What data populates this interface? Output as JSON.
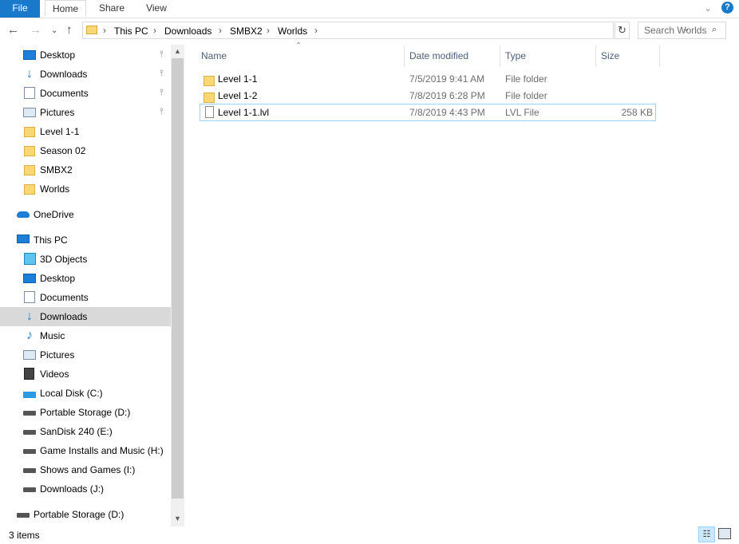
{
  "ribbon": {
    "tabs": [
      "File",
      "Home",
      "Share",
      "View"
    ],
    "help": "?",
    "chevron": "⌄"
  },
  "nav": {
    "back": "←",
    "forward": "→",
    "recent": "⌄",
    "up": "↑",
    "refresh": "↻"
  },
  "address": {
    "crumbs": [
      "This PC",
      "Downloads",
      "SMBX2",
      "Worlds"
    ],
    "sep": "›",
    "dropdown": "⌄"
  },
  "search": {
    "placeholder": "Search Worlds",
    "icon": "search-icon"
  },
  "sidebar": {
    "quick_access": [
      {
        "label": "Desktop",
        "icon": "desktop-icon",
        "pinned": true
      },
      {
        "label": "Downloads",
        "icon": "download-icon",
        "pinned": true
      },
      {
        "label": "Documents",
        "icon": "documents-icon",
        "pinned": true
      },
      {
        "label": "Pictures",
        "icon": "pictures-icon",
        "pinned": true
      },
      {
        "label": "Level 1-1",
        "icon": "folder-icon",
        "pinned": false
      },
      {
        "label": "Season 02",
        "icon": "folder-icon",
        "pinned": false
      },
      {
        "label": "SMBX2",
        "icon": "folder-icon",
        "pinned": false
      },
      {
        "label": "Worlds",
        "icon": "folder-icon",
        "pinned": false
      }
    ],
    "onedrive": {
      "label": "OneDrive",
      "icon": "cloud-icon"
    },
    "this_pc": {
      "label": "This PC",
      "icon": "computer-icon"
    },
    "pc_items": [
      {
        "label": "3D Objects",
        "icon": "3d-objects-icon"
      },
      {
        "label": "Desktop",
        "icon": "desktop-icon"
      },
      {
        "label": "Documents",
        "icon": "documents-icon"
      },
      {
        "label": "Downloads",
        "icon": "download-icon",
        "selected": true
      },
      {
        "label": "Music",
        "icon": "music-icon"
      },
      {
        "label": "Pictures",
        "icon": "pictures-icon"
      },
      {
        "label": "Videos",
        "icon": "videos-icon"
      },
      {
        "label": "Local Disk (C:)",
        "icon": "windows-drive-icon"
      },
      {
        "label": "Portable Storage (D:)",
        "icon": "drive-icon"
      },
      {
        "label": "SanDisk 240 (E:)",
        "icon": "drive-icon"
      },
      {
        "label": "Game Installs and Music (H:)",
        "icon": "drive-icon"
      },
      {
        "label": "Shows and Games (I:)",
        "icon": "drive-icon"
      },
      {
        "label": "Downloads (J:)",
        "icon": "drive-icon"
      }
    ],
    "portable": {
      "label": "Portable Storage (D:)",
      "icon": "drive-icon"
    },
    "pin_glyph": "📌",
    "scroll_up": "▲",
    "scroll_down": "▼"
  },
  "columns": {
    "name": "Name",
    "date": "Date modified",
    "type": "Type",
    "size": "Size",
    "sort_glyph": "⌃"
  },
  "files": [
    {
      "name": "Level 1-1",
      "date": "7/5/2019 9:41 AM",
      "type": "File folder",
      "size": "",
      "icon": "folder-icon"
    },
    {
      "name": "Level 1-2",
      "date": "7/8/2019 6:28 PM",
      "type": "File folder",
      "size": "",
      "icon": "folder-icon"
    },
    {
      "name": "Level 1-1.lvl",
      "date": "7/8/2019 4:43 PM",
      "type": "LVL File",
      "size": "258 KB",
      "icon": "file-icon"
    }
  ],
  "status": {
    "count": "3 items"
  },
  "colors": {
    "accent": "#1979ca",
    "selection": "#cce8ff",
    "selection_border": "#99d1ff"
  }
}
